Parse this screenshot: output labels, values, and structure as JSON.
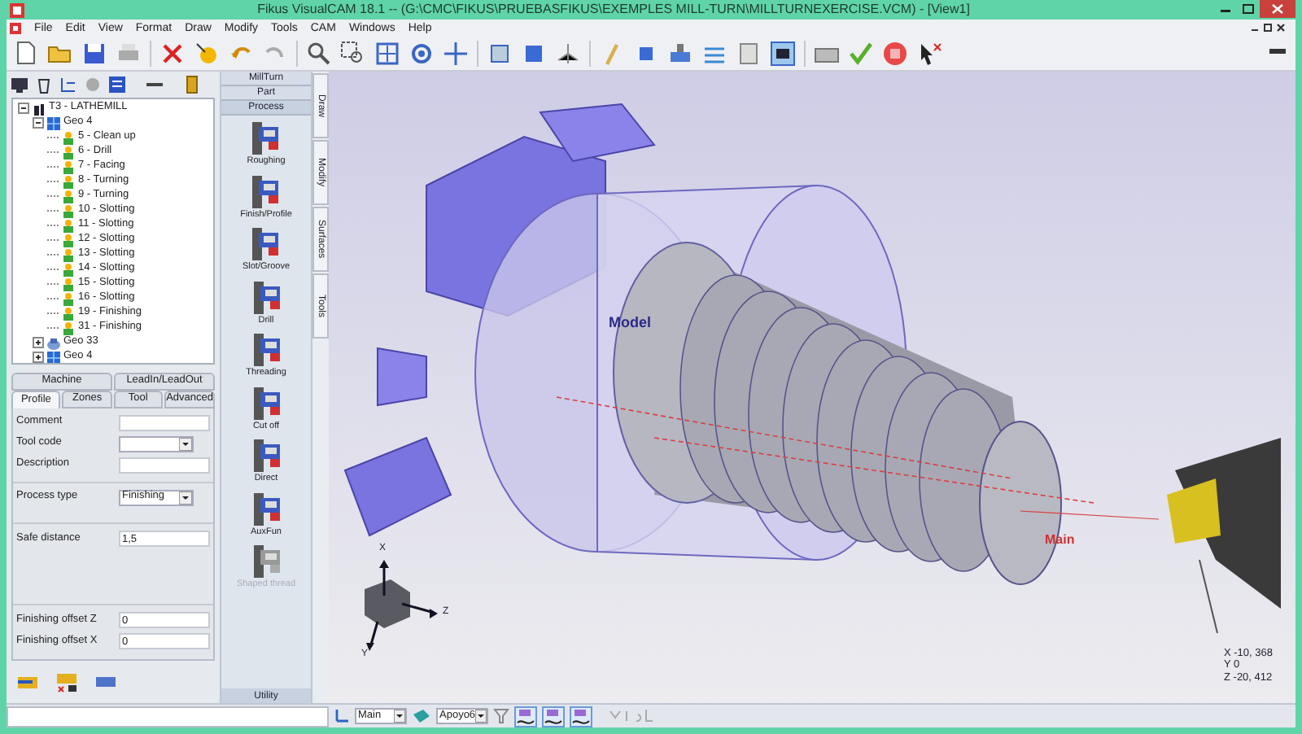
{
  "window": {
    "title": "Fikus VisualCAM 18.1 -- (G:\\CMC\\FIKUS\\PRUEBASFIKUS\\EXEMPLES MILL-TURN\\MILLTURNEXERCISE.VCM) - [View1]"
  },
  "menu": [
    "File",
    "Edit",
    "View",
    "Format",
    "Draw",
    "Modify",
    "Tools",
    "CAM",
    "Windows",
    "Help"
  ],
  "tree": [
    {
      "label": "T3 - LATHEMILL",
      "kind": "tool",
      "expanded": true,
      "children": [
        {
          "label": "Geo 4",
          "kind": "geometry",
          "expanded": true,
          "children": [
            {
              "label": "5 - Clean up",
              "kind": "operation"
            },
            {
              "label": "6 - Drill",
              "kind": "operation"
            },
            {
              "label": "7 - Facing",
              "kind": "operation"
            },
            {
              "label": "8 - Turning",
              "kind": "operation"
            },
            {
              "label": "9 - Turning",
              "kind": "operation"
            },
            {
              "label": "10 - Slotting",
              "kind": "operation"
            },
            {
              "label": "11 - Slotting",
              "kind": "operation"
            },
            {
              "label": "12 - Slotting",
              "kind": "operation"
            },
            {
              "label": "13 - Slotting",
              "kind": "operation"
            },
            {
              "label": "14 - Slotting",
              "kind": "operation"
            },
            {
              "label": "15 - Slotting",
              "kind": "operation"
            },
            {
              "label": "16 - Slotting",
              "kind": "operation"
            },
            {
              "label": "19 - Finishing",
              "kind": "operation"
            },
            {
              "label": "31 - Finishing",
              "kind": "operation"
            }
          ]
        },
        {
          "label": "Geo 33",
          "kind": "solid",
          "expanded": false
        },
        {
          "label": "Geo 4",
          "kind": "geometry",
          "expanded": false
        }
      ]
    }
  ],
  "panel_tabs": [
    [
      {
        "label": "Machine",
        "selected": false
      },
      {
        "label": "LeadIn/LeadOut",
        "selected": false
      }
    ],
    [
      {
        "label": "Profile",
        "selected": true
      },
      {
        "label": "Zones",
        "selected": false
      },
      {
        "label": "Tool",
        "selected": false
      },
      {
        "label": "Advanced",
        "selected": false
      }
    ]
  ],
  "form": [
    [
      {
        "label": "Comment",
        "kind": "text"
      },
      {
        "label": "Tool code",
        "kind": "dropdown"
      },
      {
        "label": "Description",
        "kind": "text"
      }
    ],
    [
      {
        "label": "Process type",
        "kind": "dropdown",
        "value": "Finishing"
      }
    ],
    [
      {
        "label": "Safe distance",
        "kind": "text",
        "value": "1,5"
      }
    ],
    [
      {
        "label": "Finishing offset Z",
        "kind": "text",
        "value": "0"
      },
      {
        "label": "Finishing offset X",
        "kind": "text",
        "value": "0"
      }
    ]
  ],
  "process_panel": {
    "tabs": [
      {
        "label": "MillTurn",
        "selected": false
      },
      {
        "label": "Part",
        "selected": false
      },
      {
        "label": "Process",
        "selected": true
      }
    ],
    "items": [
      {
        "label": "Roughing",
        "disabled": false
      },
      {
        "label": "Finish/Profile",
        "disabled": false
      },
      {
        "label": "Slot/Groove",
        "disabled": false
      },
      {
        "label": "Drill",
        "disabled": false
      },
      {
        "label": "Threading",
        "disabled": false
      },
      {
        "label": "Cut off",
        "disabled": false
      },
      {
        "label": "Direct",
        "disabled": false
      },
      {
        "label": "AuxFun",
        "disabled": false
      },
      {
        "label": "Shaped thread",
        "disabled": true
      }
    ],
    "footer": "Utility"
  },
  "side_tabs": [
    "Draw",
    "Modify",
    "Surfaces",
    "Tools"
  ],
  "viewport": {
    "model_label": "Model",
    "origin_label": "Main",
    "axes": [
      "X",
      "Y",
      "Z"
    ],
    "coordinates": [
      "X -10, 368",
      "Y 0",
      "Z -20, 412"
    ]
  },
  "status_bar": {
    "coordinate_system": "Main",
    "layer": "Apoyo6"
  }
}
